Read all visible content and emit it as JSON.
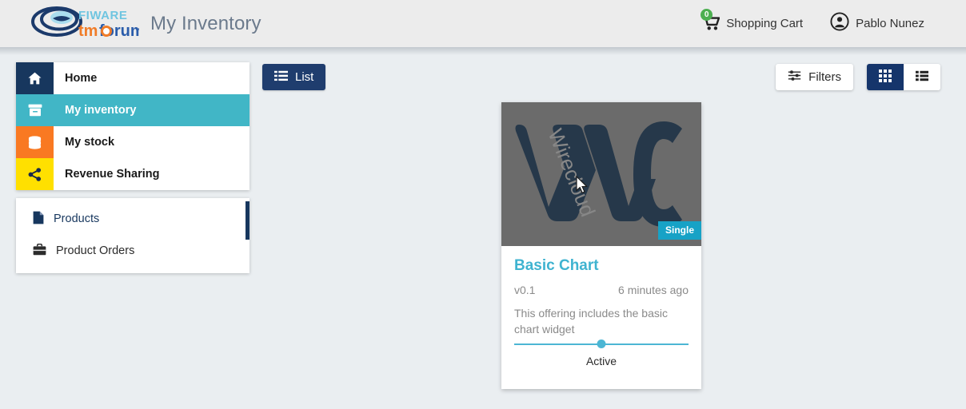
{
  "header": {
    "logo_alt": "FIWARE TM Forum",
    "title": "My Inventory",
    "cart": {
      "label": "Shopping Cart",
      "badge": "0",
      "icon": "shopping-cart-icon"
    },
    "user": {
      "name": "Pablo Nunez",
      "icon": "user-circle-icon"
    }
  },
  "sidebar": {
    "main_items": [
      {
        "label": "Home",
        "icon": "home-icon",
        "icon_bg": "#17375e",
        "active": false
      },
      {
        "label": "My inventory",
        "icon": "archive-box-icon",
        "icon_bg": "#41b6c6",
        "active": true
      },
      {
        "label": "My stock",
        "icon": "database-icon",
        "icon_bg": "#f97922",
        "active": false
      },
      {
        "label": "Revenue Sharing",
        "icon": "share-alt-icon",
        "icon_bg": "#ffe000",
        "active": false
      }
    ],
    "sub_items": [
      {
        "label": "Products",
        "icon": "file-icon"
      },
      {
        "label": "Product Orders",
        "icon": "briefcase-icon"
      }
    ]
  },
  "toolbar": {
    "list_button": {
      "label": "List",
      "icon": "list-icon"
    },
    "filters_button": {
      "label": "Filters",
      "icon": "sliders-icon"
    },
    "view_grid": {
      "icon": "grid-view-icon",
      "active": true
    },
    "view_list": {
      "icon": "list-view-icon",
      "active": false
    }
  },
  "card": {
    "image_text": "Wirecloud",
    "badge": "Single",
    "title": "Basic Chart",
    "version": "v0.1",
    "updated": "6 minutes ago",
    "description": "This offering includes the basic chart widget",
    "status": "Active"
  },
  "colors": {
    "accent_teal": "#41b6c6",
    "navy": "#17375e",
    "orange": "#f97922",
    "yellow": "#ffe000",
    "badge_green": "#4caf50",
    "title_teal": "#3fb3d0",
    "page_bg": "#eaeef1"
  }
}
